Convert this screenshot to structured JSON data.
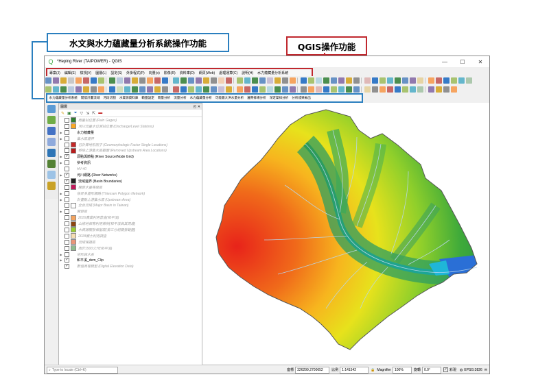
{
  "callouts": {
    "left_title": "水文與水力蘊藏量分析系統操作功能",
    "right_title": "QGIS操作功能"
  },
  "window": {
    "title": "*Heping River (TAIPOWER) - QGIS",
    "minimize": "—",
    "maximize": "☐",
    "close": "✕"
  },
  "menu": {
    "items": [
      "專案(J)",
      "編輯(E)",
      "檢視(V)",
      "圖層(L)",
      "設定(S)",
      "外掛程式(P)",
      "向量(o)",
      "影像(R)",
      "資料庫(D)",
      "網頁(Web)",
      "處理運算(C)",
      "說明(H)",
      "水力蘊藏量分析系統"
    ]
  },
  "plugin_toolbar": {
    "items": [
      "水力蘊藏量分析系統",
      "開發計畫流域",
      "河段切割",
      "水資源資料庫",
      "範圍設定",
      "雨量分析",
      "流量分析",
      "水力蘊藏量分析",
      "可能最大洪水量分析",
      "邊際排場分析",
      "深定渠排分析",
      "分析成果輸出"
    ]
  },
  "layers_panel": {
    "title": "圖層",
    "float_icon": "◰",
    "close_icon": "✕",
    "layers": [
      {
        "name": "雨量站位置 (Rain Gages)",
        "dim": true,
        "checked": false,
        "group": false,
        "color": "#2e7d32"
      },
      {
        "name": "河川流量水位測站位置 (Discharge/Level Stations)",
        "dim": true,
        "checked": false,
        "group": false,
        "color": "#f9a825"
      },
      {
        "name": "水力蘊藏量",
        "dim": false,
        "checked": false,
        "group": true,
        "color": ""
      },
      {
        "name": "集水區邊界",
        "dim": true,
        "checked": false,
        "group": true,
        "color": ""
      },
      {
        "name": "已計算地形因子 (Geomorphologic Factor Single Locations)",
        "dim": true,
        "checked": false,
        "group": false,
        "color": "#c62828"
      },
      {
        "name": "移除上游集水區範圍 (Removed Upstream Area Locations)",
        "dim": true,
        "checked": false,
        "group": false,
        "color": "#b71c1c"
      },
      {
        "name": "源點與節點 (River Source/Node Grid)",
        "dim": false,
        "checked": true,
        "group": true,
        "color": ""
      },
      {
        "name": "參考資訊",
        "dim": false,
        "checked": false,
        "group": true,
        "color": ""
      },
      {
        "name": "HV-40",
        "dim": true,
        "checked": false,
        "group": false,
        "color": ""
      },
      {
        "name": "河川網路 (River Networks)",
        "dim": false,
        "checked": true,
        "group": true,
        "color": ""
      },
      {
        "name": "流域邊界 (Basin Boundaries)",
        "dim": false,
        "checked": true,
        "group": false,
        "color": "#222222"
      },
      {
        "name": "開發水量等級區",
        "dim": true,
        "checked": false,
        "group": false,
        "color": "#c2185b"
      },
      {
        "name": "徐昇多邊形網路 (Thiessen Polygon Network)",
        "dim": true,
        "checked": false,
        "group": true,
        "color": ""
      },
      {
        "name": "計畫點上游集水區 (Upstream Area)",
        "dim": true,
        "checked": false,
        "group": true,
        "color": ""
      },
      {
        "name": "全台流域 (Major Basin in Taiwan)",
        "dim": true,
        "checked": false,
        "group": false,
        "color": "#ffffff"
      },
      {
        "name": "開發區",
        "dim": true,
        "checked": false,
        "group": true,
        "color": ""
      },
      {
        "name": "2016農業利用普查(和平溪)",
        "dim": true,
        "checked": false,
        "group": false,
        "color": "#f4a460"
      },
      {
        "name": "山坡地保育利用條例(和平溪與其周邊)",
        "dim": true,
        "checked": false,
        "group": false,
        "color": "#8b4513"
      },
      {
        "name": "水資源開發保留區(第三分組開發範圍)",
        "dim": true,
        "checked": false,
        "group": false,
        "color": "#9acd32"
      },
      {
        "name": "2018國土利用調查",
        "dim": true,
        "checked": false,
        "group": false,
        "color": "#f5deb3"
      },
      {
        "name": "流域保護區",
        "dim": true,
        "checked": false,
        "group": false,
        "color": "#e9967a"
      },
      {
        "name": "高於1500公尺(和平溪)",
        "dim": true,
        "checked": false,
        "group": false,
        "color": "#8fbc8f"
      },
      {
        "name": "地形與水系",
        "dim": true,
        "checked": false,
        "group": true,
        "color": ""
      },
      {
        "name": "和平溪_dem_Clip",
        "dim": false,
        "checked": true,
        "group": true,
        "color": ""
      },
      {
        "name": "數值高程模型 (Digital Elevation Data)",
        "dim": true,
        "checked": true,
        "group": false,
        "color": ""
      }
    ]
  },
  "status_bar": {
    "locator_placeholder": "Type to locate (Ctrl+K)",
    "coordinate_label": "座標",
    "coordinate_value": "326299,2700652",
    "scale_label": "比例",
    "scale_value": "1:141542",
    "magnifier_label": "Magnifier",
    "magnifier_value": "100%",
    "rotation_label": "旋轉",
    "rotation_value": "0.0°",
    "render_label": "彩現",
    "crs_label": "EPSG:3826"
  }
}
